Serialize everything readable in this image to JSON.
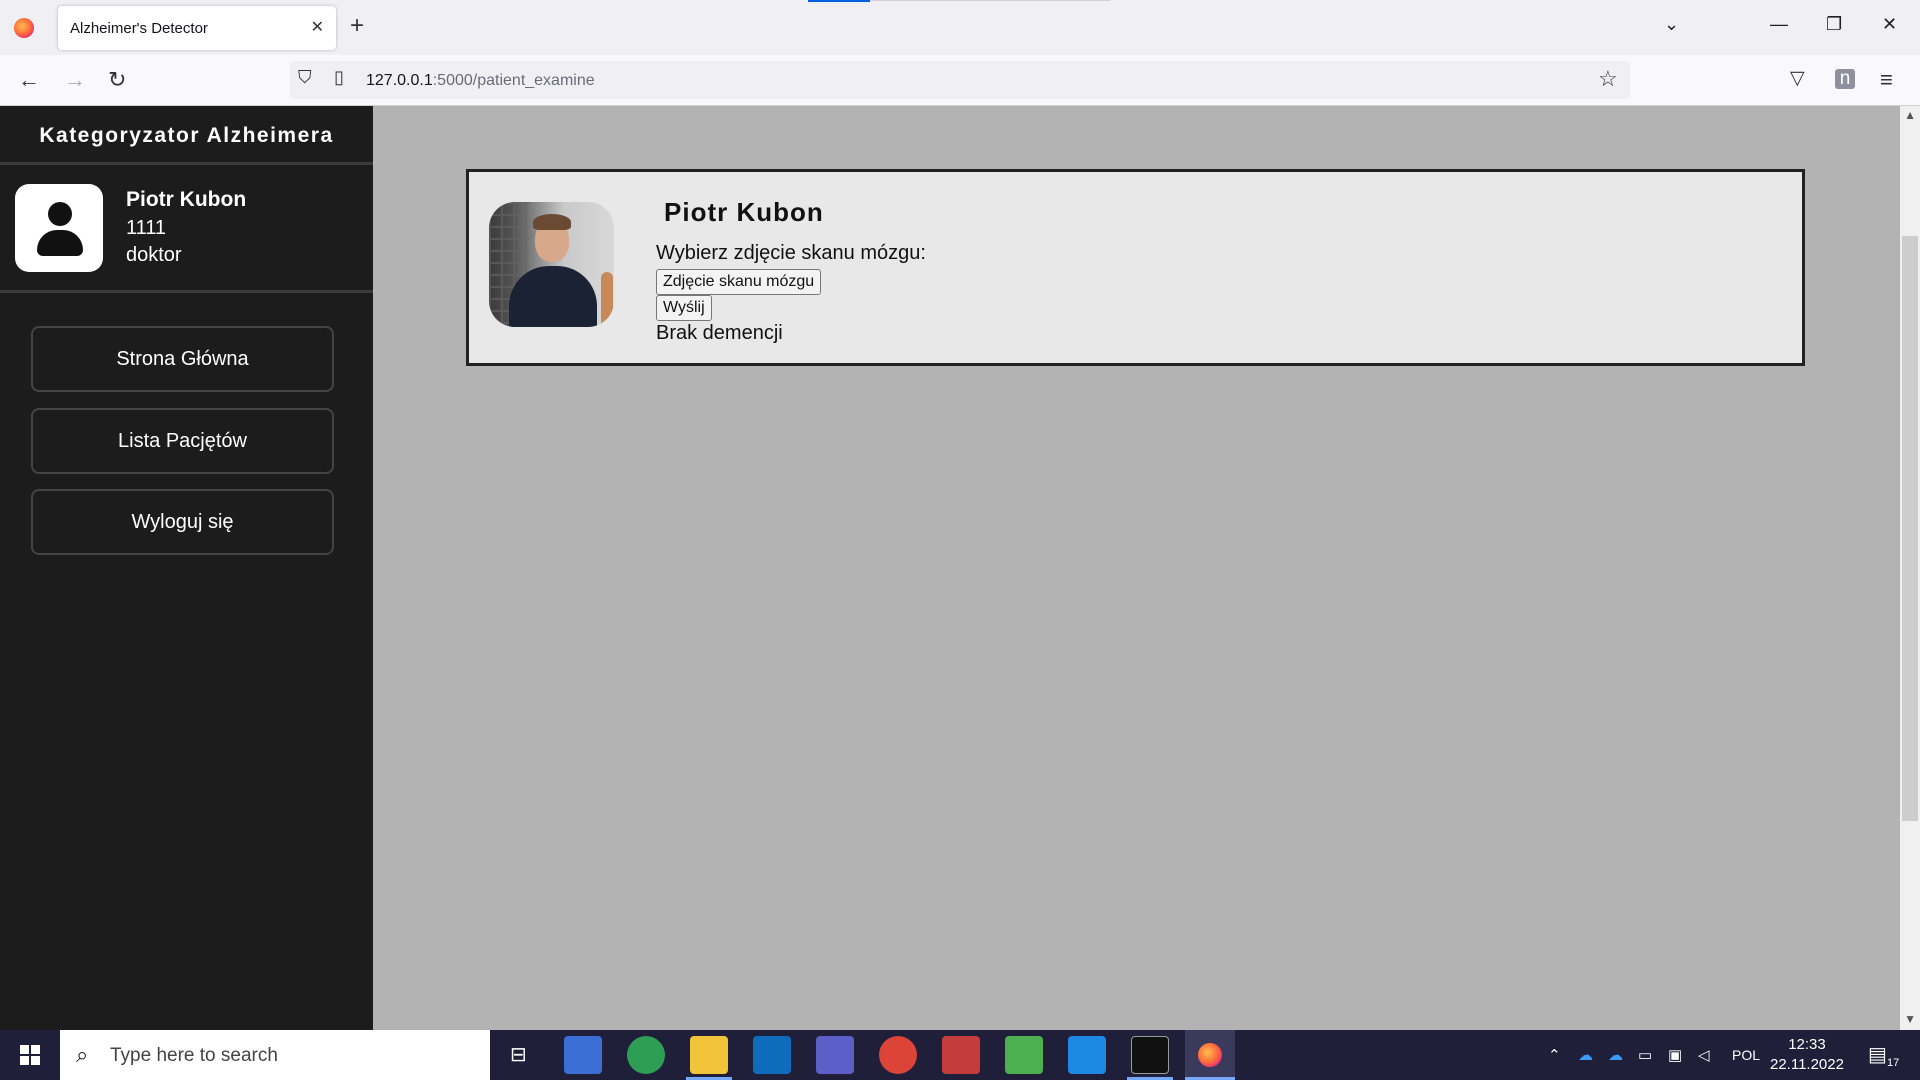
{
  "browser": {
    "tab_title": "Alzheimer's Detector",
    "tab_close": "✕",
    "new_tab": "+",
    "url_host": "127.0.0.1",
    "url_rest": ":5000/patient_examine"
  },
  "sidebar": {
    "brand": "Kategoryzator Alzheimera",
    "user": {
      "name": "Piotr Kubon",
      "id": "1111",
      "role": "doktor"
    },
    "nav": [
      {
        "label": "Strona Główna"
      },
      {
        "label": "Lista Pacjętów"
      },
      {
        "label": "Wyloguj się"
      }
    ]
  },
  "patient": {
    "name": "Piotr Kubon",
    "prompt": "Wybierz zdjęcie skanu mózgu:",
    "file_button": "Zdjęcie skanu mózgu",
    "submit_button": "Wyślij",
    "result": "Brak demencji"
  },
  "taskbar": {
    "search_placeholder": "Type here to search",
    "language": "POL",
    "time": "12:33",
    "date": "22.11.2022",
    "notifications": "17"
  },
  "colors": {
    "sidebar_bg": "#1c1c1c",
    "page_bg": "#b3b3b3",
    "card_bg": "#e8e8e8",
    "taskbar_bg": "#1f1f3a"
  }
}
